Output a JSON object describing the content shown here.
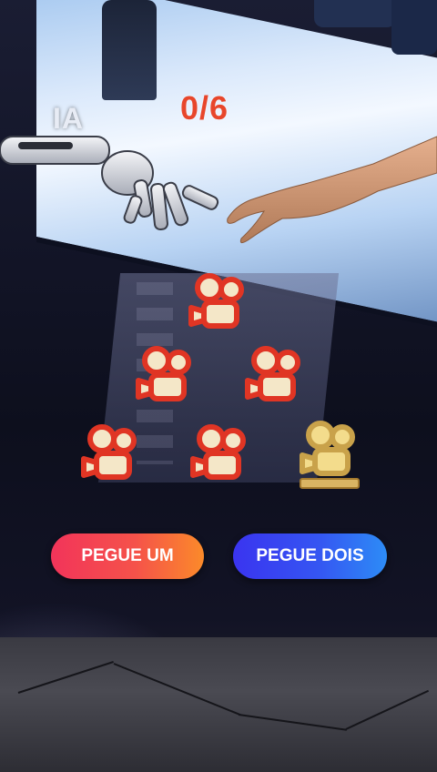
{
  "hud": {
    "player_label": "IA",
    "score": "0/6"
  },
  "buttons": {
    "take_one": "PEGUE UM",
    "take_two": "PEGUE DOIS"
  },
  "tokens": [
    {
      "name": "red-camera-token-1",
      "color": "#e03524",
      "kind": "camera"
    },
    {
      "name": "red-camera-token-2",
      "color": "#e03524",
      "kind": "camera"
    },
    {
      "name": "red-camera-token-3",
      "color": "#e03524",
      "kind": "camera"
    },
    {
      "name": "red-camera-token-4",
      "color": "#e03524",
      "kind": "camera"
    },
    {
      "name": "red-camera-token-5",
      "color": "#e03524",
      "kind": "camera"
    },
    {
      "name": "gold-camera-trophy",
      "color": "#c9a24a",
      "kind": "trophy"
    }
  ],
  "colors": {
    "score": "#e8462b",
    "take_one_start": "#f2345a",
    "take_one_end": "#fb8a2a",
    "take_two_start": "#3a34f0",
    "take_two_end": "#2d8cf6"
  }
}
